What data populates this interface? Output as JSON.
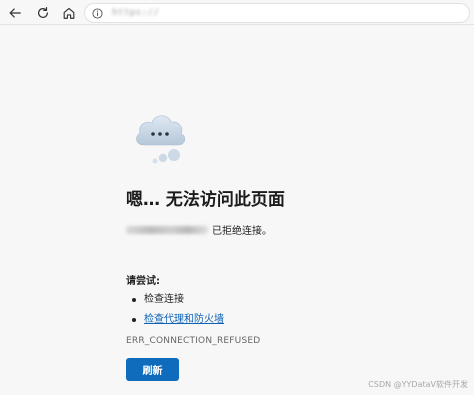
{
  "browser": {
    "url": "https://"
  },
  "error_page": {
    "title": "嗯… 无法访问此页面",
    "refused_suffix": "已拒绝连接。",
    "try_label": "请尝试:",
    "suggestions": [
      {
        "label": "检查连接",
        "is_link": false
      },
      {
        "label": "检查代理和防火墙",
        "is_link": true
      }
    ],
    "error_code": "ERR_CONNECTION_REFUSED",
    "refresh_label": "刷新"
  },
  "watermark": "CSDN @YYDataV软件开发",
  "colors": {
    "accent": "#0f6cbd",
    "link": "#0f62b5",
    "background": "#f7f7f7"
  },
  "icons": [
    "back-arrow-icon",
    "refresh-icon",
    "home-icon",
    "info-icon",
    "cloud-error-icon"
  ]
}
